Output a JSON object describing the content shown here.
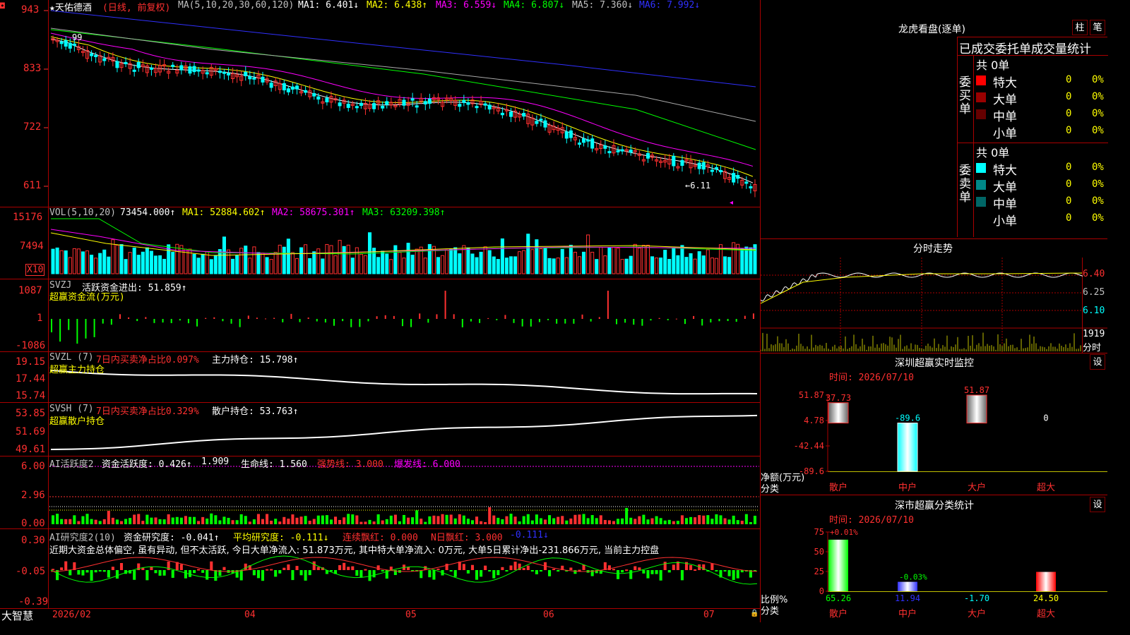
{
  "colors": {
    "up": "#ff3030",
    "down": "#00ffff",
    "grid": "#aa0000",
    "white": "#ffffff",
    "yellow": "#ffff00",
    "magenta": "#ff00ff",
    "green": "#00ff00",
    "blue": "#3030ff",
    "gray": "#aaaaaa"
  },
  "main": {
    "stock": "★天佑德酒",
    "period": "(日线, 前复权)",
    "ma_label": "MA(5,10,20,30,60,120)",
    "ma1": "MA1: 6.401↓",
    "ma2": "MA2: 6.438↑",
    "ma3": "MA3: 6.559↓",
    "ma4": "MA4: 6.807↓",
    "ma5": "MA5: 7.360↓",
    "ma6": "MA6: 7.992↓",
    "y_ticks": [
      "943",
      "833",
      "722",
      "611"
    ],
    "hi_label": "99",
    "lo_label": "←6.11",
    "flag": "◂"
  },
  "vol": {
    "label": "VOL(5,10,20)",
    "value": "73454.000↑",
    "ma1": "MA1: 52884.602↑",
    "ma2": "MA2: 58675.301↑",
    "ma3": "MA3: 63209.398↑",
    "y_ticks": [
      "15176",
      "7494"
    ],
    "unit": "X10"
  },
  "svzj": {
    "label": "SVZJ",
    "line1": "活跃资金进出: 51.859↑",
    "line2": "超赢资金流(万元)",
    "y_ticks": [
      "1087",
      "1",
      "-1086"
    ]
  },
  "svzl": {
    "label": "SVZL (7)",
    "ratio": "7日内买卖净占比0.097%",
    "hold": "主力持仓: 15.798↑",
    "line2": "超赢主力持仓",
    "y_ticks": [
      "19.15",
      "17.44",
      "15.74"
    ]
  },
  "svsh": {
    "label": "SVSH (7)",
    "ratio": "7日内买卖净占比0.329%",
    "hold": "散户持仓: 53.763↑",
    "line2": "超赢散户持仓",
    "y_ticks": [
      "53.85",
      "51.69",
      "49.61"
    ]
  },
  "ai1": {
    "label": "AI活跃度2",
    "a": "资金活跃度: 0.426↑",
    "b": "1.909",
    "c": "生命线: 1.560",
    "d": "强势线: 3.000",
    "e": "爆发线: 6.000",
    "y_ticks": [
      "6.00",
      "2.96",
      "0.00"
    ]
  },
  "ai2": {
    "label": "AI研究度2(10)",
    "a": "资金研究度: -0.041↑",
    "b": "平均研究度: -0.111↓",
    "c": "连续飘红: 0.000",
    "d": "N日飘红: 3.000",
    "e": "-0.111↓",
    "text": "近期大资金总体偏空, 虽有异动, 但不太活跃, 今日大单净流入: 51.873万元, 其中特大单净流入: 0万元, 大单5日累计净出-231.866万元, 当前主力控盘",
    "y_ticks": [
      "0.30",
      "-0.05",
      "-0.39"
    ]
  },
  "xaxis": {
    "labels": [
      "2026/02",
      "04",
      "05",
      "06",
      "07"
    ],
    "bottom_left": "大智慧"
  },
  "dragon": {
    "title": "龙虎看盘(逐单)",
    "btn1": "柱",
    "btn2": "笔",
    "tabs": "已成交委托单成交量统计",
    "buy_side": "委买单",
    "sell_side": "委卖单",
    "total_label": "共 0单",
    "rows": [
      "特大",
      "大单",
      "中单",
      "小单"
    ],
    "buy_colors": [
      "#ff0000",
      "#990000",
      "#660000",
      "#000000"
    ],
    "sell_colors": [
      "#00ffff",
      "#008888",
      "#006666",
      "#000000"
    ],
    "val": "0",
    "pct": "0%"
  },
  "intraday": {
    "title": "分时走势",
    "prices": [
      "6.40",
      "6.25",
      "6.10"
    ],
    "vol_tick": "1919",
    "vol_label": "分时"
  },
  "sz_monitor": {
    "title": "深圳超赢实时监控",
    "settings": "设",
    "time": "时间: 2026/07/10",
    "y_ticks": [
      "51.87",
      "4.78",
      "-42.44",
      "-89.6"
    ],
    "left_label1": "净额(万元)",
    "left_label2": "分类",
    "categories": [
      "散户",
      "中户",
      "大户",
      "超大"
    ],
    "bar_values": [
      37.73,
      -89.6,
      51.87,
      0
    ],
    "bar_labels": [
      "37.73",
      "-89.6",
      "51.87",
      "0"
    ]
  },
  "sz_classify": {
    "title": "深市超赢分类统计",
    "settings": "设",
    "time": "时间: 2026/07/10",
    "y_ticks": [
      "75",
      "50",
      "25",
      "0"
    ],
    "top_label": "+0.01%",
    "mid_label": "-0.03%",
    "left_label1": "比例%",
    "left_label2": "分类",
    "categories": [
      "散户",
      "中户",
      "大户",
      "超大"
    ],
    "values": [
      "65.26",
      "11.94",
      "-1.70",
      "24.50"
    ],
    "bar_heights": [
      65.26,
      11.94,
      0,
      24.5
    ]
  }
}
